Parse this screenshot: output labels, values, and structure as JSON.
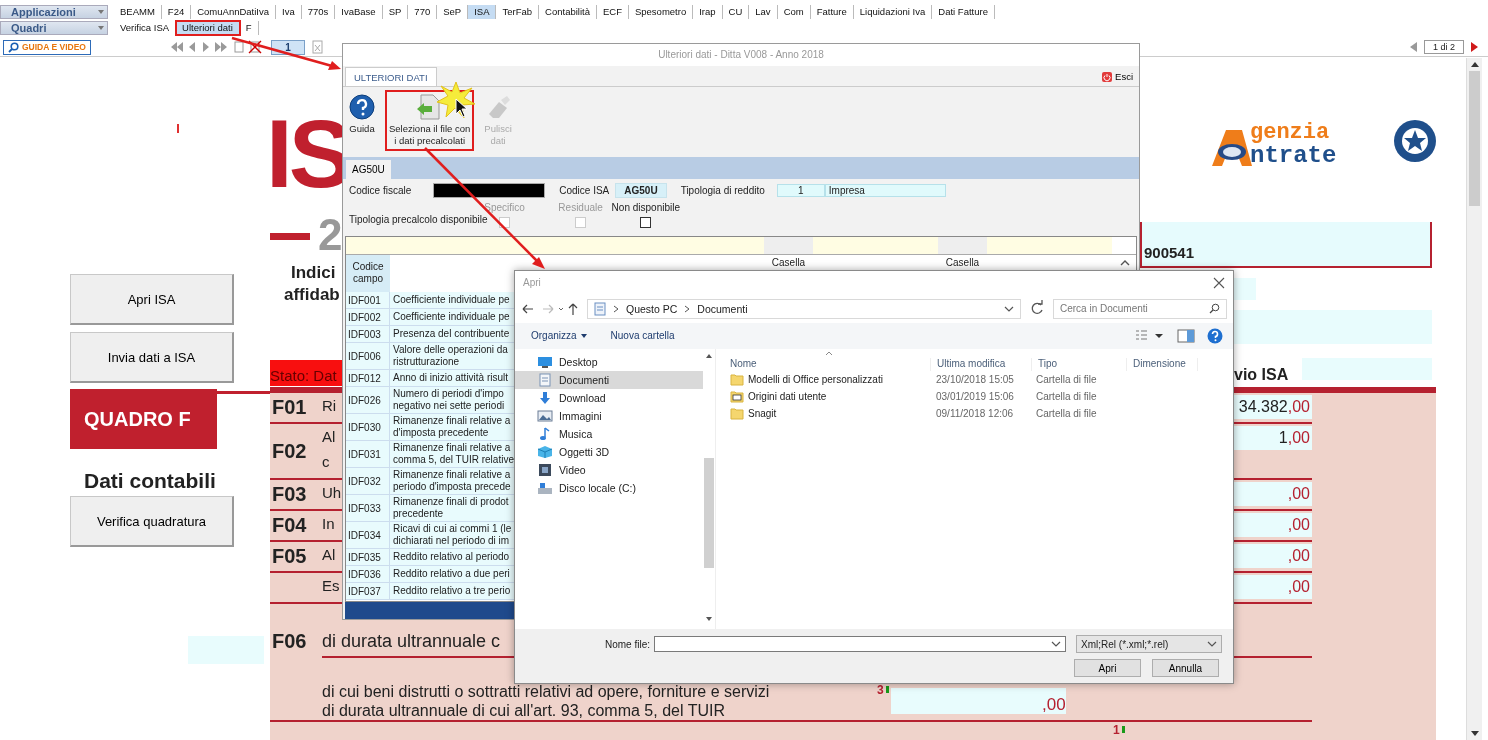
{
  "menu": {
    "apps_label": "Applicazioni",
    "apps_tabs": [
      {
        "label": "BEAMM",
        "selected": false
      },
      {
        "label": "F24",
        "selected": false
      },
      {
        "label": "ComuAnnDatiIva",
        "selected": false
      },
      {
        "label": "Iva",
        "selected": false
      },
      {
        "label": "770s",
        "selected": false
      },
      {
        "label": "IvaBase",
        "selected": false
      },
      {
        "label": "SP",
        "selected": false
      },
      {
        "label": "770",
        "selected": false
      },
      {
        "label": "SeP",
        "selected": false
      },
      {
        "label": "ISA",
        "selected": true
      },
      {
        "label": "TerFab",
        "selected": false
      },
      {
        "label": "Contabilità",
        "selected": false
      },
      {
        "label": "ECF",
        "selected": false
      },
      {
        "label": "Spesometro",
        "selected": false
      },
      {
        "label": "Irap",
        "selected": false
      },
      {
        "label": "CU",
        "selected": false
      },
      {
        "label": "Lav",
        "selected": false
      },
      {
        "label": "Com",
        "selected": false
      },
      {
        "label": "Fatture",
        "selected": false
      },
      {
        "label": "Liquidazioni Iva",
        "selected": false
      },
      {
        "label": "Dati Fatture",
        "selected": false
      }
    ],
    "quadri_label": "Quadri",
    "quadri_tabs": [
      {
        "label": "Verifica ISA",
        "selected": false,
        "highlighted": false
      },
      {
        "label": "Ulteriori dati",
        "selected": true,
        "highlighted": true
      },
      {
        "label": "F",
        "selected": false,
        "highlighted": false
      }
    ]
  },
  "nav": {
    "guide_button": "GUIDA E VIDEO",
    "page": "1",
    "page_count": "1 di 2"
  },
  "form": {
    "isa_logo": {
      "letters": "IS",
      "year": "2",
      "subtitle_1": "Indici",
      "subtitle_2": "affidab"
    },
    "agency_logo": {
      "line_1": "genzia",
      "line_2": "ntrate"
    },
    "code_value": "900541",
    "buttons": [
      "Apri ISA",
      "Invia dati a ISA",
      "Verifica quadratura"
    ],
    "section_title": "QUADRO F",
    "section_subtitle": "Dati contabili",
    "status": "Stato: Dat",
    "column_header": "vio ISA",
    "rows": [
      {
        "code": "F01",
        "lines": [
          "Ri"
        ],
        "value": "34.382",
        "decimals": ",00"
      },
      {
        "code": "F02",
        "lines": [
          "Al",
          "c"
        ],
        "value": "1",
        "decimals": ",00"
      },
      {
        "code": "F03",
        "lines": [
          "Uh"
        ],
        "decimals": ",00"
      },
      {
        "code": "F04",
        "lines": [
          "In"
        ],
        "decimals": ",00"
      },
      {
        "code": "F05",
        "lines": [
          "Al"
        ],
        "decimals": ",00"
      },
      {
        "lines": [
          "Es"
        ],
        "decimals": ",00"
      }
    ],
    "f06": {
      "code": "F06",
      "line": "di durata ultrannuale c",
      "detail": "di cui beni distrutti o sottratti relativi ad opere, forniture e servizi\ndi durata ultrannuale di cui all'art. 93, comma 5, del TUIR",
      "box_number": "3",
      "decimals": ",00",
      "next_box_number": "1"
    }
  },
  "dialog": {
    "title": "Ulteriori dati - Ditta V008 - Anno 2018",
    "tab": "ULTERIORI DATI",
    "close_label": "Esci",
    "ribbon": [
      {
        "label": "Guida",
        "kind": "help",
        "disabled": false,
        "highlighted": false
      },
      {
        "label": "Seleziona il file con\ni dati precalcolati",
        "kind": "load",
        "disabled": false,
        "highlighted": true
      },
      {
        "label": "Pulisci\ndati",
        "kind": "clear",
        "disabled": true,
        "highlighted": false
      }
    ],
    "sheet_tab": "AG50U",
    "tax_code": {
      "label": "Codice fiscale",
      "redacted": true
    },
    "isa_code": {
      "label": "Codice ISA",
      "value": "AG50U"
    },
    "income_type": {
      "label": "Tipologia di reddito",
      "code": "1",
      "value": "Impresa"
    },
    "precalc_label": "Tipologia precalcolo disponibile",
    "checkboxes": [
      {
        "label": "Specifico",
        "checked": false,
        "disabled": true
      },
      {
        "label": "Residuale",
        "checked": false,
        "disabled": true
      },
      {
        "label": "Non disponibile",
        "checked": false,
        "disabled": false
      }
    ],
    "table": {
      "code_header": "Codice campo",
      "box_headers": [
        "Casella",
        "Casella"
      ],
      "rows": [
        {
          "code": "IDF001",
          "text": "Coefficiente individuale pe"
        },
        {
          "code": "IDF002",
          "text": "Coefficiente individuale pe"
        },
        {
          "code": "IDF003",
          "text": "Presenza del contribuente"
        },
        {
          "code": "IDF006",
          "text": "Valore delle operazioni da\nristrutturazione"
        },
        {
          "code": "IDF012",
          "text": "Anno di inizio attività risult"
        },
        {
          "code": "IDF026",
          "text": "Numero di periodi d'impo\nnegativo nei sette periodi"
        },
        {
          "code": "IDF030",
          "text": "Rimanenze finali relative a\nd'imposta precedente"
        },
        {
          "code": "IDF031",
          "text": "Rimanenze finali relative a\ncomma 5, del TUIR relative"
        },
        {
          "code": "IDF032",
          "text": "Rimanenze finali relative a\nperiodo d'imposta precede"
        },
        {
          "code": "IDF033",
          "text": "Rimanenze finali di prodot\nprecedente"
        },
        {
          "code": "IDF034",
          "text": "Ricavi di cui ai commi 1 (le\ndichiarati nel periodo di im"
        },
        {
          "code": "IDF035",
          "text": "Reddito relativo al periodo"
        },
        {
          "code": "IDF036",
          "text": "Reddito relativo a due peri"
        },
        {
          "code": "IDF037",
          "text": "Reddito relativo a tre perio"
        }
      ]
    }
  },
  "file_dialog": {
    "title": "Apri",
    "path": [
      "Questo PC",
      "Documenti"
    ],
    "search_placeholder": "Cerca in Documenti",
    "toolbar": [
      {
        "label": "Organizza",
        "kind": "menu"
      },
      {
        "label": "Nuova cartella",
        "kind": "button"
      }
    ],
    "nav_items": [
      {
        "label": "Desktop",
        "kind": "desktop",
        "selected": false
      },
      {
        "label": "Documenti",
        "kind": "documents",
        "selected": true
      },
      {
        "label": "Download",
        "kind": "download",
        "selected": false
      },
      {
        "label": "Immagini",
        "kind": "pictures",
        "selected": false
      },
      {
        "label": "Musica",
        "kind": "music",
        "selected": false
      },
      {
        "label": "Oggetti 3D",
        "kind": "objects",
        "selected": false
      },
      {
        "label": "Video",
        "kind": "video",
        "selected": false
      },
      {
        "label": "Disco locale (C:)",
        "kind": "drive",
        "selected": false
      }
    ],
    "columns": [
      "Nome",
      "Ultima modifica",
      "Tipo",
      "Dimensione"
    ],
    "files": [
      {
        "name": "Modelli di Office personalizzati",
        "modified": "23/10/2018 15:05",
        "type": "Cartella di file",
        "kind": "folder"
      },
      {
        "name": "Origini dati utente",
        "modified": "03/01/2019 15:06",
        "type": "Cartella di file",
        "kind": "special"
      },
      {
        "name": "Snagit",
        "modified": "09/11/2018 12:06",
        "type": "Cartella di file",
        "kind": "folder"
      }
    ],
    "file_name_label": "Nome file:",
    "filter": "Xml;Rel (*.xml;*.rel)",
    "buttons": [
      "Apri",
      "Annulla"
    ]
  }
}
